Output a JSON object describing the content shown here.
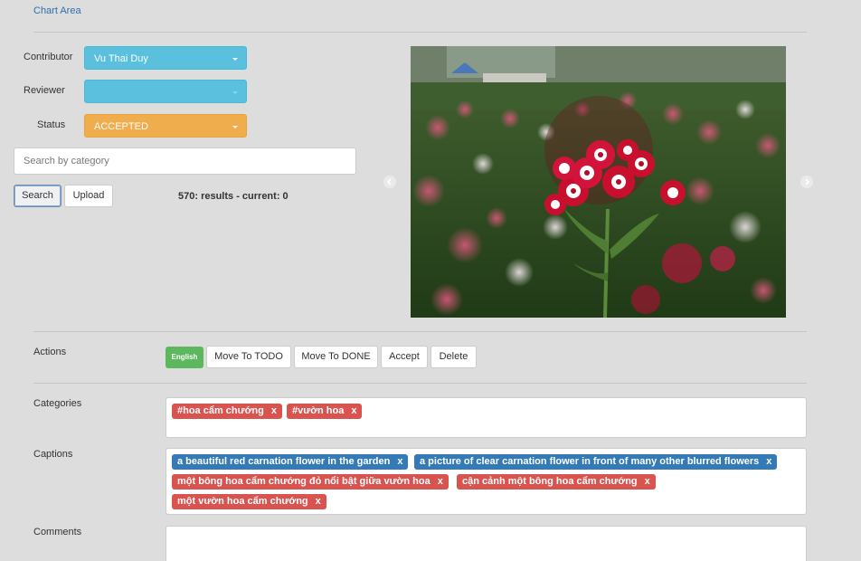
{
  "breadcrumb": "Chart Area",
  "filters": {
    "contributor_label": "Contributor",
    "contributor_value": "Vu Thai Duy",
    "reviewer_label": "Reviewer",
    "reviewer_value": "",
    "status_label": "Status",
    "status_value": "ACCEPTED",
    "search_placeholder": "Search by category"
  },
  "buttons": {
    "search": "Search",
    "upload": "Upload"
  },
  "results_text": "570: results - current: 0",
  "actions": {
    "label": "Actions",
    "language": "English",
    "move_todo": "Move To TODO",
    "move_done": "Move To DONE",
    "accept": "Accept",
    "delete": "Delete"
  },
  "categories": {
    "label": "Categories",
    "tags": [
      "#hoa cẩm chướng",
      "#vườn hoa"
    ]
  },
  "captions": {
    "label": "Captions",
    "tags": [
      "a beautiful red carnation flower in the garden",
      "a picture of clear carnation flower in front of many other blurred flowers",
      "một bông hoa cẩm chướng đỏ nổi bật giữa vườn hoa",
      "cận cảnh một bông hoa cẩm chướng",
      "một vườn hoa cẩm chướng"
    ]
  },
  "comments": {
    "label": "Comments"
  },
  "tag_remove": "x",
  "colors": {
    "info": "#5bc0de",
    "warning": "#f0ad4e",
    "success": "#5cb85c",
    "danger": "#d9534f",
    "primary": "#337ab7"
  }
}
